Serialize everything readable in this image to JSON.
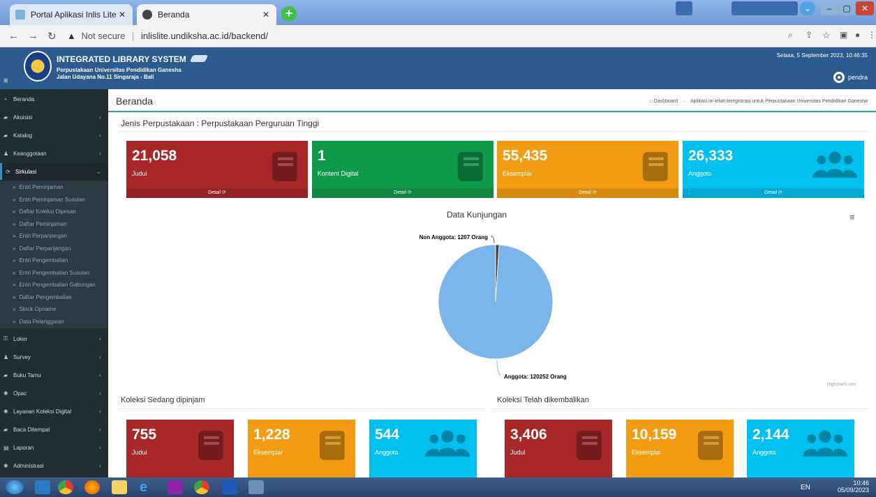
{
  "browser": {
    "tabs": [
      {
        "label": "Portal Aplikasi Inlis Lite"
      },
      {
        "label": "Beranda"
      }
    ],
    "new_tab": "+",
    "url_warning": "Not secure",
    "url": "inlislite.undiksha.ac.id/backend/"
  },
  "header": {
    "title": "INTEGRATED LIBRARY SYSTEM",
    "subtitle1": "Perpustakaan Universitas Pendidikan Ganesha",
    "subtitle2": "Jalan Udayana No.11 Singaraja - Bali",
    "datetime": "Selasa, 5 September 2023, 10:46:35",
    "username": "pendra"
  },
  "sidebar": {
    "items": [
      {
        "label": "Beranda",
        "icon": "dashboard-icon",
        "has_chevron": false
      },
      {
        "label": "Akuisisi",
        "icon": "book-icon",
        "has_chevron": true
      },
      {
        "label": "Katalog",
        "icon": "book-icon",
        "has_chevron": true
      },
      {
        "label": "Keanggotaan",
        "icon": "user-icon",
        "has_chevron": true
      },
      {
        "label": "Sirkulasi",
        "icon": "refresh-icon",
        "has_chevron": true,
        "active": true
      }
    ],
    "subitems": [
      "Entri Peminjaman",
      "Entri Peminjaman Susulan",
      "Daftar Koleksi Dipesan",
      "Daftar Peminjaman",
      "Entri Perpanjangan",
      "Daftar Perpanjangan",
      "Entri Pengembalian",
      "Entri Pengembalian Susulan",
      "Entri Pengembalian Gabungan",
      "Daftar Pengembalian",
      "Stock Opname",
      "Data Pelanggaran"
    ],
    "items_after": [
      {
        "label": "Loker",
        "icon": "key-icon"
      },
      {
        "label": "Survey",
        "icon": "group-icon"
      },
      {
        "label": "Buku Tamu",
        "icon": "book-icon"
      },
      {
        "label": "Opac",
        "icon": "gear-icon"
      },
      {
        "label": "Layanan Koleksi Digital",
        "icon": "gear-icon"
      },
      {
        "label": "Baca Ditempat",
        "icon": "book-icon"
      },
      {
        "label": "Laporan",
        "icon": "report-icon"
      },
      {
        "label": "Administrasi",
        "icon": "gear-icon"
      }
    ],
    "sub_prefix": "»",
    "chevron": "‹",
    "chevron_active": "⌄"
  },
  "main": {
    "page_title": "Beranda",
    "breadcrumb_home": "Dashboard",
    "breadcrumb_note": "Aplikasi ini telah teregistrasi untuk Perpustakaan Universitas Pendidikan Ganesha",
    "jenis": "Jenis Perpustakaan : Perpustakaan Perguruan Tinggi",
    "stat_boxes": [
      {
        "value": "21,058",
        "label": "Judul",
        "footer": "Detail ⟳",
        "color": "#a8282a",
        "icon": "book-icon"
      },
      {
        "value": "1",
        "label": "Kontent Digital",
        "footer": "Detail ⟳",
        "color": "#0f9a4b",
        "icon": "book-icon"
      },
      {
        "value": "55,435",
        "label": "Eksemplar",
        "footer": "Detail ⟳",
        "color": "#f39c12",
        "icon": "book-icon"
      },
      {
        "value": "26,333",
        "label": "Anggota",
        "footer": "Detail ⟳",
        "color": "#00c0ef",
        "icon": "users-icon"
      }
    ],
    "chart_credits": "Highcharts.com",
    "section_borrowed": "Koleksi Sedang dipinjam",
    "section_returned": "Koleksi Telah dikembalikan",
    "borrowed_boxes": [
      {
        "value": "755",
        "label": "Judul",
        "color": "#a8282a",
        "icon": "book-icon"
      },
      {
        "value": "1,228",
        "label": "Eksemplar",
        "color": "#f39c12",
        "icon": "book-icon"
      },
      {
        "value": "544",
        "label": "Anggota",
        "color": "#00c0ef",
        "icon": "users-icon"
      }
    ],
    "returned_boxes": [
      {
        "value": "3,406",
        "label": "Judul",
        "color": "#a8282a",
        "icon": "book-icon"
      },
      {
        "value": "10,159",
        "label": "Eksemplar",
        "color": "#f39c12",
        "icon": "book-icon"
      },
      {
        "value": "2,144",
        "label": "Anggota",
        "color": "#00c0ef",
        "icon": "users-icon"
      }
    ]
  },
  "chart_data": {
    "type": "pie",
    "title": "Data Kunjungan",
    "categories": [
      "Non Anggota",
      "Anggota"
    ],
    "values": [
      1207,
      120252
    ],
    "data_labels": [
      "Non Anggota: 1207 Orang",
      "Anggota: 120252 Orang"
    ],
    "colors": [
      "#434348",
      "#7cb5ec"
    ]
  },
  "taskbar": {
    "lang": "EN",
    "time": "10:46",
    "date": "05/09/2023"
  }
}
